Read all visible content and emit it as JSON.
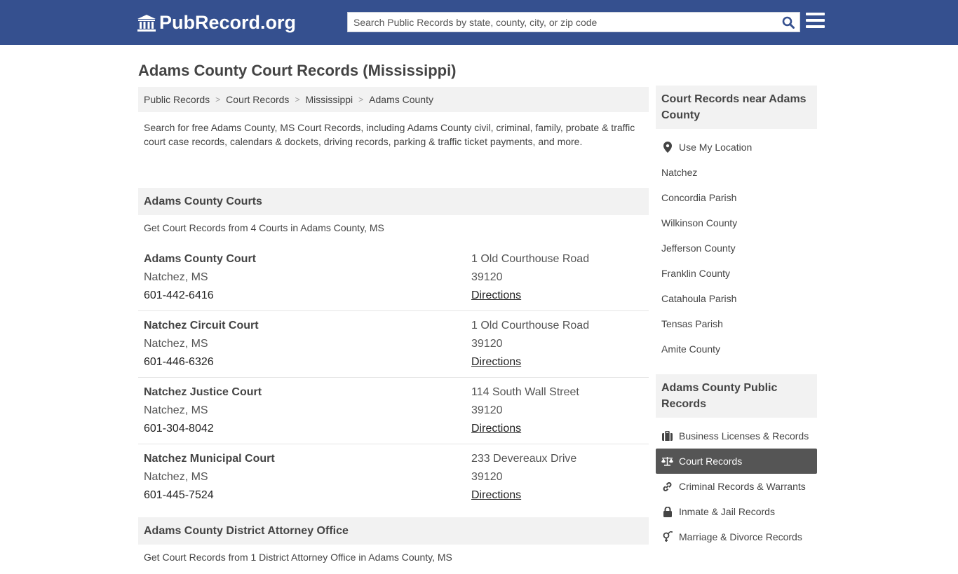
{
  "header": {
    "logo_text": "PubRecord.org",
    "search_placeholder": "Search Public Records by state, county, city, or zip code",
    "search_value": ""
  },
  "page": {
    "title": "Adams County Court Records (Mississippi)",
    "breadcrumb": [
      "Public Records",
      "Court Records",
      "Mississippi",
      "Adams County"
    ],
    "intro": "Search for free Adams County, MS Court Records, including Adams County civil, criminal, family, probate & traffic court case records, calendars & dockets, driving records, parking & traffic ticket payments, and more."
  },
  "courts_section": {
    "heading": "Adams County Courts",
    "subtitle": "Get Court Records from 4 Courts in Adams County, MS",
    "items": [
      {
        "name": "Adams County Court",
        "city": "Natchez, MS",
        "phone": "601-442-6416",
        "address": "1 Old Courthouse Road",
        "zip": "39120",
        "directions": "Directions"
      },
      {
        "name": "Natchez Circuit Court",
        "city": "Natchez, MS",
        "phone": "601-446-6326",
        "address": "1 Old Courthouse Road",
        "zip": "39120",
        "directions": "Directions"
      },
      {
        "name": "Natchez Justice Court",
        "city": "Natchez, MS",
        "phone": "601-304-8042",
        "address": "114 South Wall Street",
        "zip": "39120",
        "directions": "Directions"
      },
      {
        "name": "Natchez Municipal Court",
        "city": "Natchez, MS",
        "phone": "601-445-7524",
        "address": "233 Devereaux Drive",
        "zip": "39120",
        "directions": "Directions"
      }
    ]
  },
  "da_section": {
    "heading": "Adams County District Attorney Office",
    "subtitle": "Get Court Records from 1 District Attorney Office in Adams County, MS"
  },
  "sidebar": {
    "nearby_heading": "Court Records near Adams County",
    "use_location": "Use My Location",
    "nearby": [
      "Natchez",
      "Concordia Parish",
      "Wilkinson County",
      "Jefferson County",
      "Franklin County",
      "Catahoula Parish",
      "Tensas Parish",
      "Amite County"
    ],
    "public_heading": "Adams County Public Records",
    "public_items": [
      {
        "label": "Business Licenses & Records",
        "icon": "briefcase-icon",
        "active": false
      },
      {
        "label": "Court Records",
        "icon": "balance-scale-icon",
        "active": true
      },
      {
        "label": "Criminal Records & Warrants",
        "icon": "link-icon",
        "active": false
      },
      {
        "label": "Inmate & Jail Records",
        "icon": "lock-icon",
        "active": false
      },
      {
        "label": "Marriage & Divorce Records",
        "icon": "venus-mars-icon",
        "active": false
      }
    ]
  },
  "colors": {
    "header_bg": "#35508f",
    "search_icon": "#35508f",
    "active_item_bg": "#555555"
  }
}
